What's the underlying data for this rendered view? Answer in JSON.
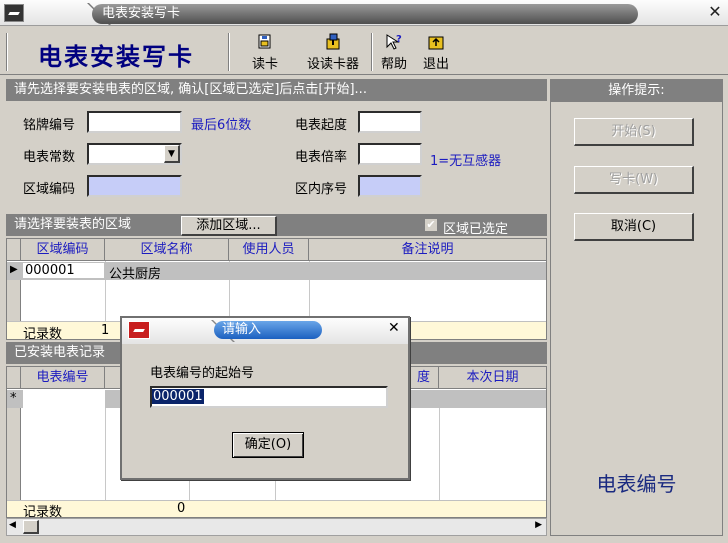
{
  "window": {
    "title": "电表安装写卡"
  },
  "toolbar": {
    "app_title": "电表安装写卡",
    "read_card": "读卡",
    "set_reader": "设读卡器",
    "help": "帮助",
    "exit": "退出"
  },
  "form": {
    "header": "请先选择要安装电表的区域, 确认[区域已选定]后点击[开始]...",
    "nameplate_label": "铭牌编号",
    "nameplate_value": "",
    "nameplate_hint": "最后6位数",
    "start_reading_label": "电表起度",
    "start_reading_value": "",
    "constant_label": "电表常数",
    "constant_value": "",
    "ratio_label": "电表倍率",
    "ratio_value": "",
    "ratio_hint": "1=无互感器",
    "area_code_label": "区域编码",
    "area_code_value": "",
    "area_seq_label": "区内序号",
    "area_seq_value": ""
  },
  "area_section": {
    "header": "请选择要装表的区域",
    "add_button": "添加区域...",
    "confirmed_label": "区域已选定",
    "confirmed_checked": true,
    "columns": [
      "区域编码",
      "区域名称",
      "使用人员",
      "备注说明"
    ],
    "rows": [
      {
        "code": "000001",
        "name": "公共厨房",
        "user": "",
        "note": ""
      }
    ],
    "count_label": "记录数",
    "count_value": "1"
  },
  "installed_section": {
    "header": "已安装电表记录",
    "columns": [
      "电表编号",
      "度",
      "本次日期"
    ],
    "new_row_marker": "*",
    "count_label": "记录数",
    "count_value": "0"
  },
  "side_panel": {
    "header": "操作提示:",
    "start_button": "开始(S)",
    "write_button": "写卡(W)",
    "cancel_button": "取消(C)",
    "hint_text": "电表编号"
  },
  "dialog": {
    "title": "请输入",
    "prompt": "电表编号的起始号",
    "input_value": "000001",
    "ok_button": "确定(O)"
  }
}
